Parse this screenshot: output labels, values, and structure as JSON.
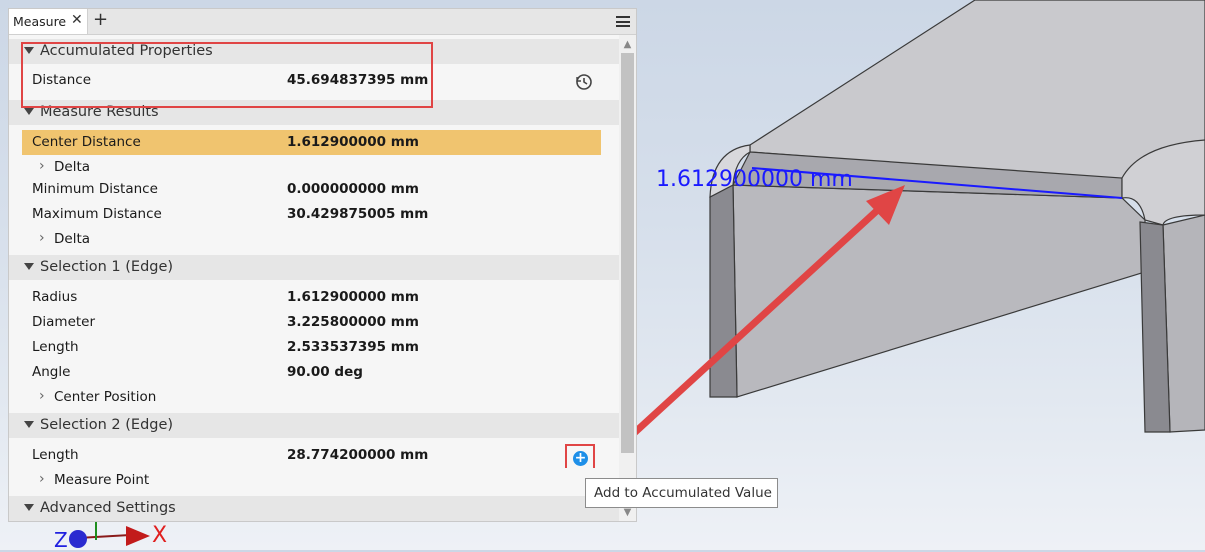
{
  "panel": {
    "tab_label": "Measure",
    "tab_close": "✕",
    "tab_add": "+"
  },
  "accumulated": {
    "header": "Accumulated Properties",
    "label": "Distance",
    "value": "45.694837395 mm"
  },
  "results": {
    "header": "Measure Results",
    "center_label": "Center Distance",
    "center_value": "1.612900000 mm",
    "delta1": "Delta",
    "min_label": "Minimum Distance",
    "min_value": "0.000000000 mm",
    "max_label": "Maximum Distance",
    "max_value": "30.429875005 mm",
    "delta2": "Delta"
  },
  "selection1": {
    "header": "Selection 1 (Edge)",
    "radius_label": "Radius",
    "radius_value": "1.612900000 mm",
    "diameter_label": "Diameter",
    "diameter_value": "3.225800000 mm",
    "length_label": "Length",
    "length_value": "2.533537395 mm",
    "angle_label": "Angle",
    "angle_value": "90.00 deg",
    "center_position": "Center Position"
  },
  "selection2": {
    "header": "Selection 2 (Edge)",
    "length_label": "Length",
    "length_value": "28.774200000 mm",
    "measure_point": "Measure Point"
  },
  "advanced": {
    "header": "Advanced Settings"
  },
  "tooltip": "Add to Accumulated Value",
  "viewport": {
    "dimension_text": "1.612900000 mm",
    "axis_x": "X",
    "axis_z": "Z"
  },
  "colors": {
    "highlight": "#f0c46f",
    "annotation_red": "#e04545",
    "dimension_blue": "#1a1aff"
  }
}
